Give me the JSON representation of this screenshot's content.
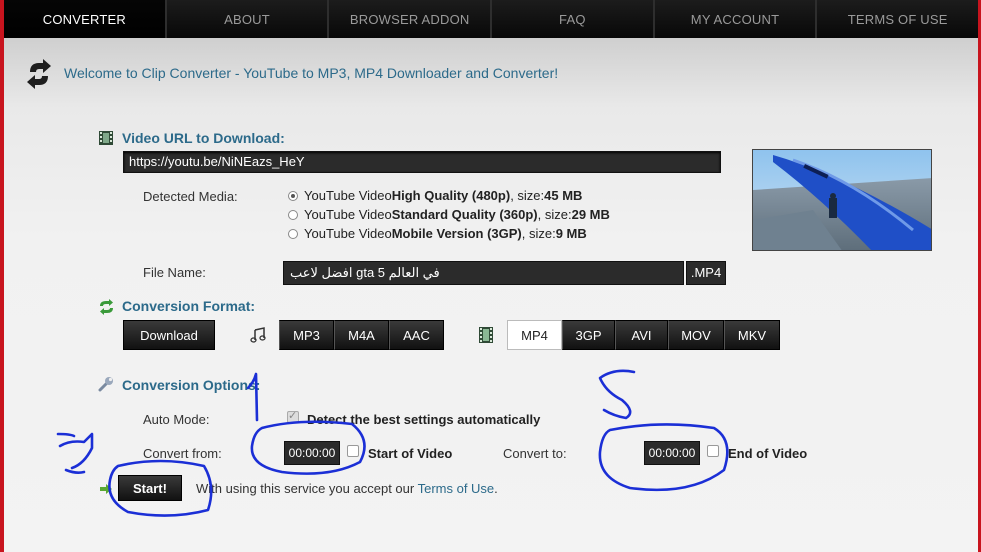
{
  "nav": {
    "items": [
      "CONVERTER",
      "ABOUT",
      "BROWSER ADDON",
      "FAQ",
      "MY ACCOUNT",
      "TERMS OF USE"
    ],
    "active_index": 0
  },
  "welcome": "Welcome to Clip Converter - YouTube to MP3, MP4 Downloader and Converter!",
  "video_url": {
    "title": "Video URL to Download:",
    "value": "https://youtu.be/NiNEazs_HeY"
  },
  "detected_media": {
    "label": "Detected Media:",
    "options": [
      {
        "prefix": "YouTube Video ",
        "quality": "High Quality (480p)",
        "suffix": ", size: ",
        "size": "45 MB",
        "checked": true
      },
      {
        "prefix": "YouTube Video ",
        "quality": "Standard Quality (360p)",
        "suffix": ", size: ",
        "size": "29 MB",
        "checked": false
      },
      {
        "prefix": "YouTube Video ",
        "quality": "Mobile Version (3GP)",
        "suffix": ", size: ",
        "size": "9 MB",
        "checked": false
      }
    ]
  },
  "file_name": {
    "label": "File Name:",
    "value": "في العالم gta 5 افضل لاعب",
    "extension": ".MP4"
  },
  "conversion_format": {
    "title": "Conversion Format:",
    "download_label": "Download",
    "audio_formats": [
      "MP3",
      "M4A",
      "AAC"
    ],
    "video_formats": [
      "MP4",
      "3GP",
      "AVI",
      "MOV",
      "MKV"
    ],
    "selected": "MP4"
  },
  "conversion_options": {
    "title": "Conversion Options:",
    "auto_mode_label": "Auto Mode:",
    "auto_mode_text": "Detect the best settings automatically",
    "convert_from_label": "Convert from:",
    "convert_from_value": "00:00:00",
    "start_of_video": "Start of Video",
    "convert_to_label": "Convert to:",
    "convert_to_value": "00:00:00",
    "end_of_video": "End of Video"
  },
  "start": {
    "label": "Start!",
    "terms_prefix": "With using this service you accept our ",
    "terms_link": "Terms of Use",
    "terms_suffix": "."
  },
  "colors": {
    "accent": "#2c6a8a",
    "frame": "#c8141e",
    "annotation": "#1b2fd6"
  }
}
